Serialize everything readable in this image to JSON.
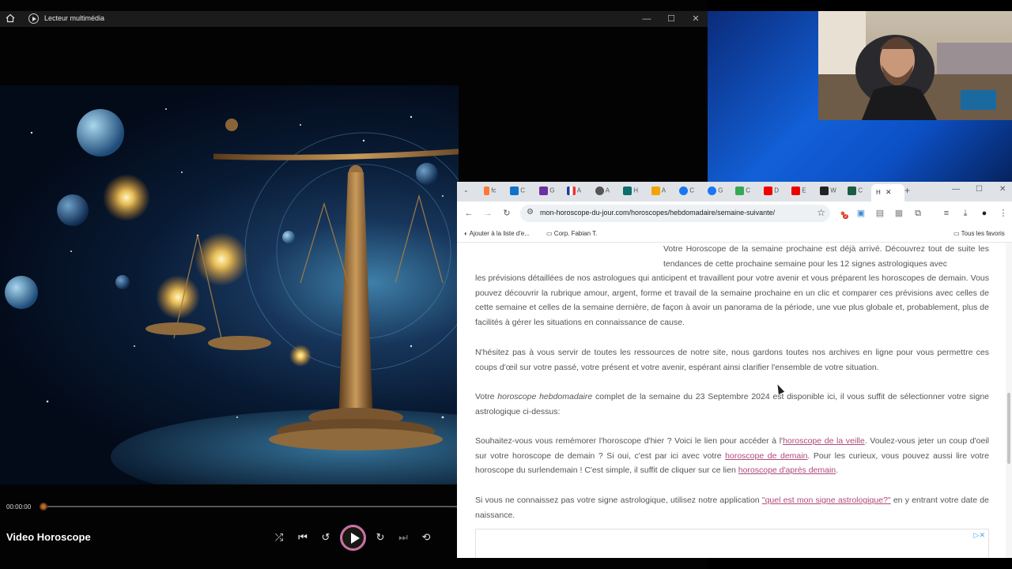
{
  "player": {
    "title": "Lecteur multimédia",
    "media_title": "Video Horoscope",
    "time": "00:00:00",
    "progress_fraction": 0.0,
    "window_buttons": [
      "—",
      "☐",
      "✕"
    ]
  },
  "browser": {
    "tabs": [
      "fc",
      "C",
      "G",
      "A",
      "A",
      "H",
      "A",
      "C",
      "G",
      "C",
      "D",
      "E",
      "W",
      "C"
    ],
    "active_tab": "H",
    "url": "mon-horoscope-du-jour.com/horoscopes/hebdomadaire/semaine-suivante/",
    "bookmarks": {
      "reading_list": "Ajouter à la liste d'e...",
      "folder": "Corp. Fabian T.",
      "all": "Tous les favoris"
    },
    "notification_count": "2"
  },
  "content": {
    "p1_line0": "Votre Horoscope de la semaine prochaine est déjà arrivé. Découvrez tout de suite",
    "p1_line1": "les tendances de cette prochaine semaine pour les 12 signes astrologiques avec",
    "p1_rest": "les prévisions détaillées de nos astrologues qui anticipent et travaillent pour votre avenir et vous préparent les horoscopes de demain. Vous pouvez découvrir la rubrique amour, argent, forme et travail de la semaine prochaine en un clic et comparer ces prévisions avec celles de cette semaine et celles de la semaine dernière, de façon à avoir un panorama de la période, une vue plus globale et, probablement, plus de facilités à gérer les situations en connaissance de cause.",
    "p2": "N'hésitez pas à vous servir de toutes les ressources de notre site, nous gardons toutes nos archives en ligne pour vous permettre ces coups d'œil sur votre passé, votre présent et votre avenir, espérant ainsi clarifier l'ensemble de votre situation.",
    "p3_a": "Votre ",
    "p3_em": "horoscope hebdomadaire",
    "p3_b": " complet de la semaine du 23 Septembre 2024 est disponible ici, il vous suffit de sélectionner votre signe astrologique ci-dessus:",
    "p4_a": "Souhaitez-vous vous remémorer l'horoscope d'hier ? Voici le lien pour accéder à l'",
    "p4_link1": "horoscope de la veille",
    "p4_b": ". Voulez-vous jeter un coup d'oeil sur votre horoscope de demain ? Si oui, c'est par ici avec votre ",
    "p4_link2": "horoscope de demain",
    "p4_c": ". Pour les curieux, vous pouvez aussi lire votre horoscope du surlendemain ! C'est simple, il suffit de cliquer sur ce lien ",
    "p4_link3": "horoscope d'après demain",
    "p4_d": ".",
    "p5_a": "Si vous ne connaissez pas votre signe astrologique, utilisez notre application ",
    "p5_link": "\"quel est mon signe astrologique?\"",
    "p5_b": " en y entrant votre date de naissance."
  },
  "icons": {
    "home": "home-icon",
    "back": "arrow-left-icon",
    "forward": "arrow-right-icon",
    "reload": "reload-icon",
    "star": "star-icon",
    "extensions": "puzzle-icon",
    "download": "download-icon",
    "menu": "kebab-menu-icon"
  }
}
